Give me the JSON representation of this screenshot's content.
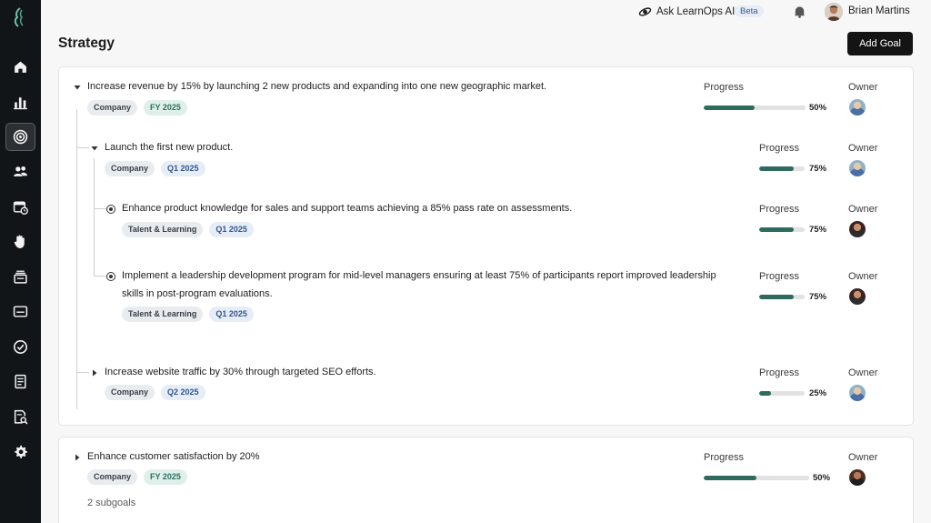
{
  "sidebar": {
    "items": [
      {
        "icon": "home-icon"
      },
      {
        "icon": "bar-chart-icon"
      },
      {
        "icon": "target-icon",
        "active": true
      },
      {
        "icon": "users-icon"
      },
      {
        "icon": "calendar-clock-icon"
      },
      {
        "icon": "hand-icon"
      },
      {
        "icon": "stack-icon"
      },
      {
        "icon": "card-icon"
      },
      {
        "icon": "check-circle-icon"
      },
      {
        "icon": "document-icon"
      },
      {
        "icon": "search-document-icon"
      },
      {
        "icon": "gear-icon"
      }
    ]
  },
  "topbar": {
    "ask_label": "Ask LearnOps AI",
    "beta_label": "Beta",
    "user_name": "Brian Martins"
  },
  "page": {
    "title": "Strategy",
    "add_goal_label": "Add Goal"
  },
  "labels": {
    "progress": "Progress",
    "owner": "Owner"
  },
  "goals": [
    {
      "title": "Increase revenue by 15% by launching 2 new products and expanding into one new geographic market.",
      "tags": [
        "Company",
        "FY 2025"
      ],
      "progress_pct": 50,
      "progress_text": "50%",
      "expanded": true
    },
    {
      "title": "Launch the first new product.",
      "tags": [
        "Company",
        "Q1 2025"
      ],
      "progress_pct": 75,
      "progress_text": "75%",
      "expanded": true
    },
    {
      "title": "Enhance product knowledge for sales and support teams achieving a 85% pass rate on assessments.",
      "tags": [
        "Talent & Learning",
        "Q1 2025"
      ],
      "progress_pct": 75,
      "progress_text": "75%"
    },
    {
      "title_line1": "Implement a leadership development program for mid-level managers ensuring at least 75% of participants report improved leadership",
      "title_line2": "skills in post-program evaluations.",
      "tags": [
        "Talent & Learning",
        "Q1 2025"
      ],
      "progress_pct": 75,
      "progress_text": "75%"
    },
    {
      "title": "Increase website traffic by 30% through targeted SEO efforts.",
      "tags": [
        "Company",
        "Q2 2025"
      ],
      "progress_pct": 25,
      "progress_text": "25%",
      "expanded": false
    },
    {
      "title": "Enhance customer satisfaction by 20%",
      "tags": [
        "Company",
        "FY 2025"
      ],
      "progress_pct": 50,
      "progress_text": "50%",
      "expanded": false,
      "subgoals_text": "2 subgoals"
    }
  ],
  "colors": {
    "sidebar_bg": "#111518",
    "progress_fill": "#2e6b5e",
    "primary_button": "#141414"
  }
}
